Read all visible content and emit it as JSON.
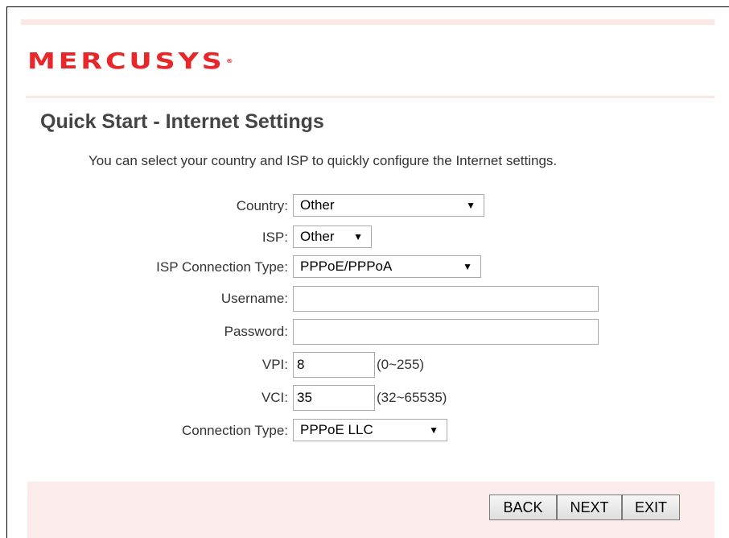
{
  "brand": {
    "logo_text": "MERCUSYS",
    "logo_mark": "®",
    "accent": "#e8272a"
  },
  "page": {
    "title": "Quick Start - Internet Settings",
    "intro": "You can select your country and ISP to quickly configure the Internet settings."
  },
  "form": {
    "country": {
      "label": "Country:",
      "value": "Other"
    },
    "isp": {
      "label": "ISP:",
      "value": "Other"
    },
    "isp_connection_type": {
      "label": "ISP Connection Type:",
      "value": "PPPoE/PPPoA"
    },
    "username": {
      "label": "Username:",
      "value": ""
    },
    "password": {
      "label": "Password:",
      "value": ""
    },
    "vpi": {
      "label": "VPI:",
      "value": "8",
      "hint": "(0~255)"
    },
    "vci": {
      "label": "VCI:",
      "value": "35",
      "hint": "(32~65535)"
    },
    "connection_type": {
      "label": "Connection Type:",
      "value": "PPPoE LLC"
    }
  },
  "buttons": {
    "back": "BACK",
    "next": "NEXT",
    "exit": "EXIT"
  },
  "icons": {
    "dropdown": "dropdown-arrow-icon"
  }
}
